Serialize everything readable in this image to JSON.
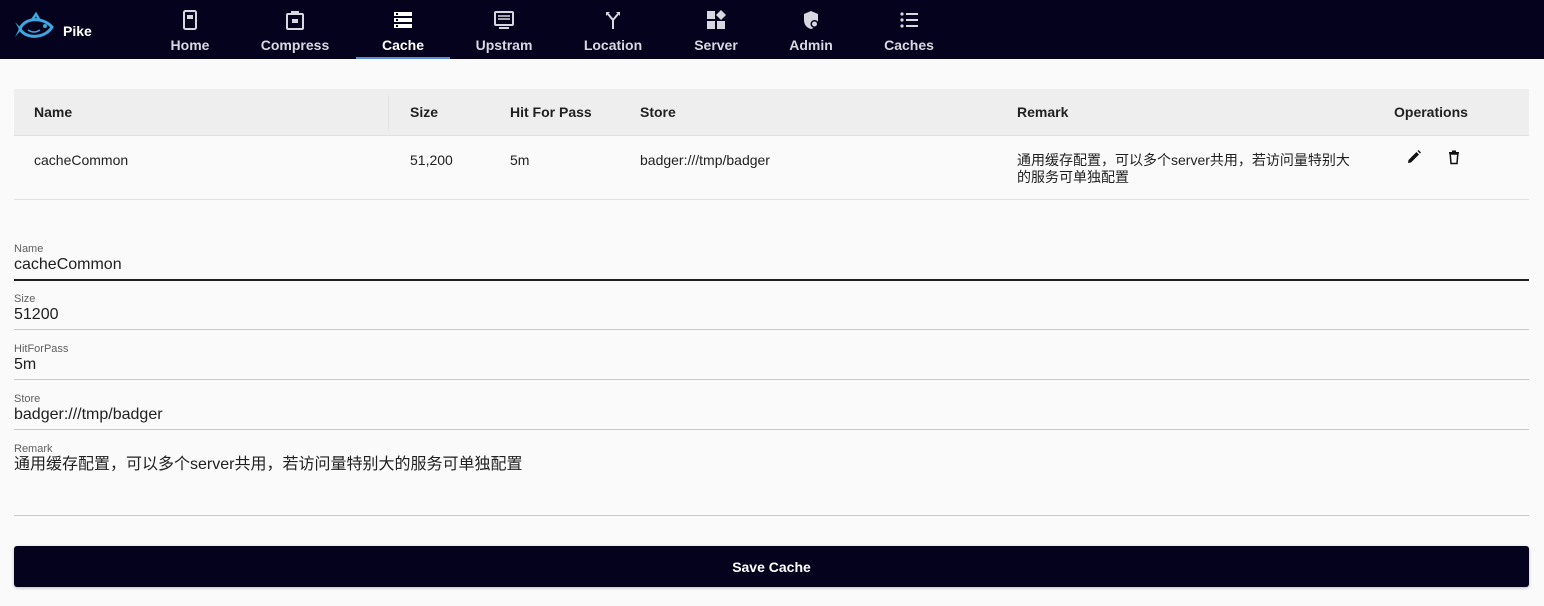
{
  "app": {
    "name": "Pike",
    "logo_icon": "fish-logo-icon"
  },
  "colors": {
    "topbar": "#04021c",
    "active_underline": "#5b8dd6",
    "primary_button": "#04021c"
  },
  "nav": {
    "tabs": [
      {
        "label": "Home",
        "icon": "home-icon"
      },
      {
        "label": "Compress",
        "icon": "compress-icon"
      },
      {
        "label": "Cache",
        "icon": "cache-icon",
        "active": true
      },
      {
        "label": "Upstram",
        "icon": "upstream-icon"
      },
      {
        "label": "Location",
        "icon": "location-icon"
      },
      {
        "label": "Server",
        "icon": "server-icon"
      },
      {
        "label": "Admin",
        "icon": "admin-icon"
      },
      {
        "label": "Caches",
        "icon": "caches-icon"
      }
    ]
  },
  "table": {
    "headers": [
      "Name",
      "Size",
      "Hit For Pass",
      "Store",
      "Remark",
      "Operations"
    ],
    "rows": [
      {
        "name": "cacheCommon",
        "size": "51,200",
        "hit_for_pass": "5m",
        "store": "badger:///tmp/badger",
        "remark": "通用缓存配置，可以多个server共用，若访问量特别大的服务可单独配置",
        "operations": [
          "edit-icon",
          "delete-icon"
        ]
      }
    ]
  },
  "form": {
    "name": {
      "label": "Name",
      "value": "cacheCommon"
    },
    "size": {
      "label": "Size",
      "value": "51200"
    },
    "hit_for_pass": {
      "label": "HitForPass",
      "value": "5m"
    },
    "store": {
      "label": "Store",
      "value": "badger:///tmp/badger"
    },
    "remark": {
      "label": "Remark",
      "value": "通用缓存配置，可以多个server共用，若访问量特别大的服务可单独配置"
    },
    "save_label": "Save Cache"
  }
}
